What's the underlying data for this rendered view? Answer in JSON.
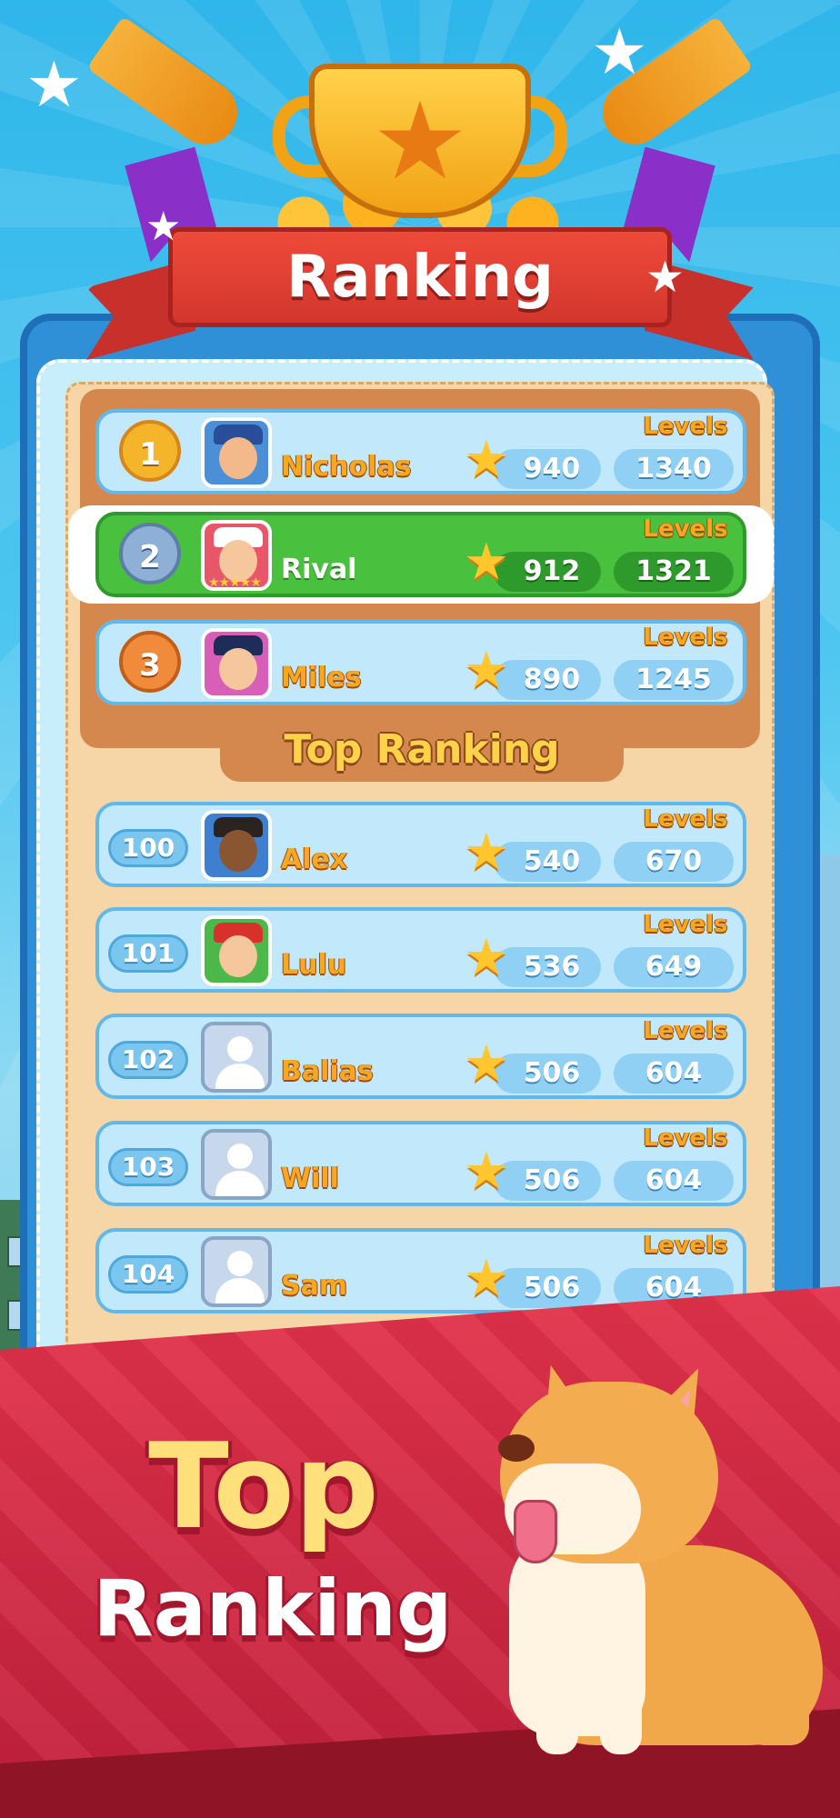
{
  "header": {
    "title": "Ranking"
  },
  "podium": [
    {
      "rank": "1",
      "name": "Nicholas",
      "stars": "940",
      "levels_label": "Levels",
      "levels": "1340",
      "medal": "gold",
      "avatar": "police-officer-avatar"
    },
    {
      "rank": "2",
      "name": "Rival",
      "stars": "912",
      "levels_label": "Levels",
      "levels": "1321",
      "medal": "silver",
      "avatar": "nurse-avatar",
      "highlighted": true
    },
    {
      "rank": "3",
      "name": "Miles",
      "stars": "890",
      "levels_label": "Levels",
      "levels": "1245",
      "medal": "bronze",
      "avatar": "pilot-avatar"
    }
  ],
  "section_title": "Top Ranking",
  "list": [
    {
      "rank": "100",
      "name": "Alex",
      "stars": "540",
      "levels_label": "Levels",
      "levels": "670",
      "avatar": "headphones-avatar"
    },
    {
      "rank": "101",
      "name": "Lulu",
      "stars": "536",
      "levels_label": "Levels",
      "levels": "649",
      "avatar": "red-hat-girl-avatar"
    },
    {
      "rank": "102",
      "name": "Balias",
      "stars": "506",
      "levels_label": "Levels",
      "levels": "604",
      "avatar": "default-user-avatar"
    },
    {
      "rank": "103",
      "name": "Will",
      "stars": "506",
      "levels_label": "Levels",
      "levels": "604",
      "avatar": "default-user-avatar"
    },
    {
      "rank": "104",
      "name": "Sam",
      "stars": "506",
      "levels_label": "Levels",
      "levels": "604",
      "avatar": "default-user-avatar"
    }
  ],
  "promo": {
    "line1": "Top",
    "line2": "Ranking"
  },
  "icons": {
    "star": "★",
    "trophy_star": "★",
    "deco_star": "★"
  },
  "colors": {
    "highlight_row": "#49c13e",
    "row": "#c2e8fb",
    "banner": "#d8283f",
    "accent_gold": "#f7a823"
  }
}
